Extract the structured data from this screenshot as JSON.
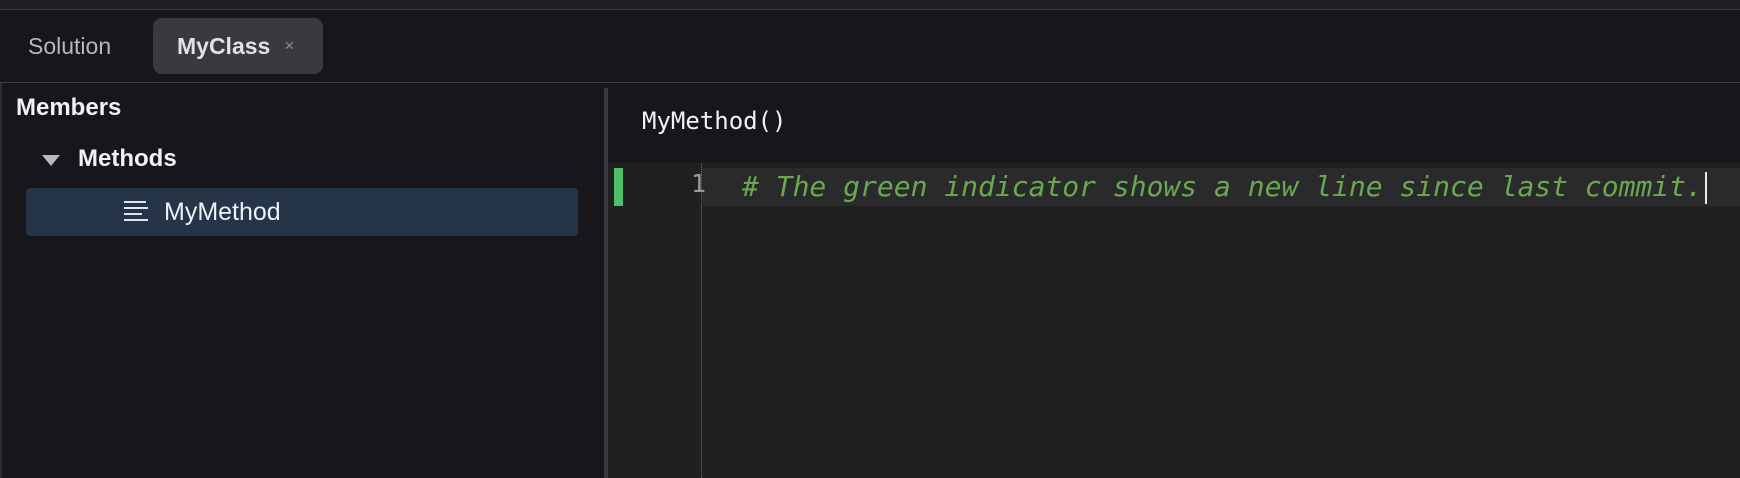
{
  "tabs": [
    {
      "label": "Solution",
      "active": false
    },
    {
      "label": "MyClass",
      "active": true,
      "close_glyph": "×"
    }
  ],
  "sidebar": {
    "title": "Members",
    "group": {
      "label": "Methods",
      "icon": "triangle-down-icon",
      "expanded": true
    },
    "items": [
      {
        "label": "MyMethod",
        "icon": "method-lines-icon",
        "selected": true
      }
    ]
  },
  "editor": {
    "title": "MyMethod()",
    "lines": [
      {
        "number": "1",
        "text": "# The green indicator shows a new line since last commit.",
        "change": "added"
      }
    ]
  },
  "colors": {
    "background": "#17171b",
    "editor_background": "#202020",
    "selection": "#263448",
    "change_indicator": "#4fc06a",
    "comment": "#6aa84f",
    "active_tab": "#3a3a3e"
  }
}
